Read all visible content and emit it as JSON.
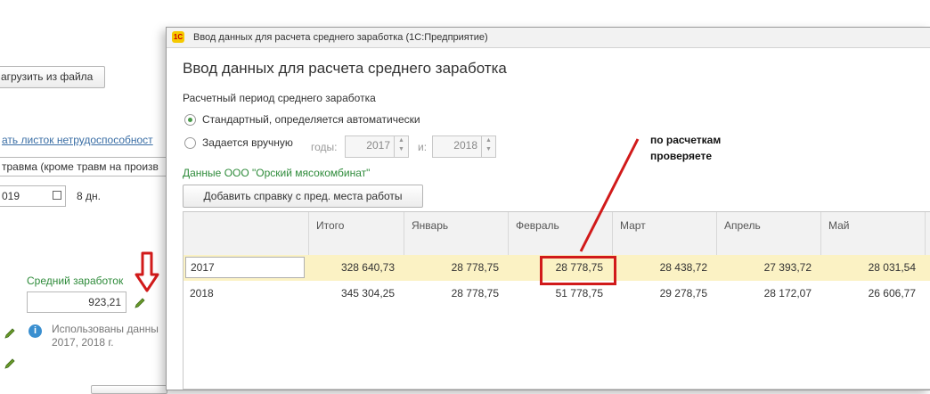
{
  "background_form": {
    "load_button": "агрузить из файла",
    "sick_list_link": "ать листок нетрудоспособност",
    "injury_field": "травма (кроме травм на произв",
    "date_field": "019",
    "days_text": "8 дн.",
    "avg_earnings_label": "Средний заработок",
    "avg_earnings_value": "923,21",
    "info_text_line1": "Использованы данны",
    "info_text_line2": "2017,  2018 г."
  },
  "window": {
    "title": "Ввод данных для расчета среднего заработка  (1С:Предприятие)",
    "logo": "1С",
    "heading": "Ввод данных для расчета среднего заработка",
    "period_label": "Расчетный период среднего заработка",
    "radio_standard": "Стандартный, определяется автоматически",
    "radio_manual": "Задается вручную",
    "years_label": "годы:",
    "year_from": "2017",
    "to_label": "и:",
    "year_to": "2018",
    "org_data_label": "Данные ООО \"Орский мясокомбинат\"",
    "add_certificate_button": "Добавить справку с пред. места работы"
  },
  "table": {
    "columns": [
      "Итого",
      "Январь",
      "Февраль",
      "Март",
      "Апрель",
      "Май"
    ],
    "rows": [
      {
        "year": "2017",
        "values": [
          "328 640,73",
          "28 778,75",
          "28 778,75",
          "28 438,72",
          "27 393,72",
          "28 031,54"
        ]
      },
      {
        "year": "2018",
        "values": [
          "345 304,25",
          "28 778,75",
          "51 778,75",
          "29 278,75",
          "28 172,07",
          "26 606,77"
        ]
      }
    ]
  },
  "annotation": {
    "line1": "по расчеткам",
    "line2": "проверяете"
  },
  "colors": {
    "highlight": "#d11a1a",
    "selected_row": "#fbf2c4",
    "green_text": "#2e8b3a",
    "download_arrow": "#d11a1a"
  }
}
